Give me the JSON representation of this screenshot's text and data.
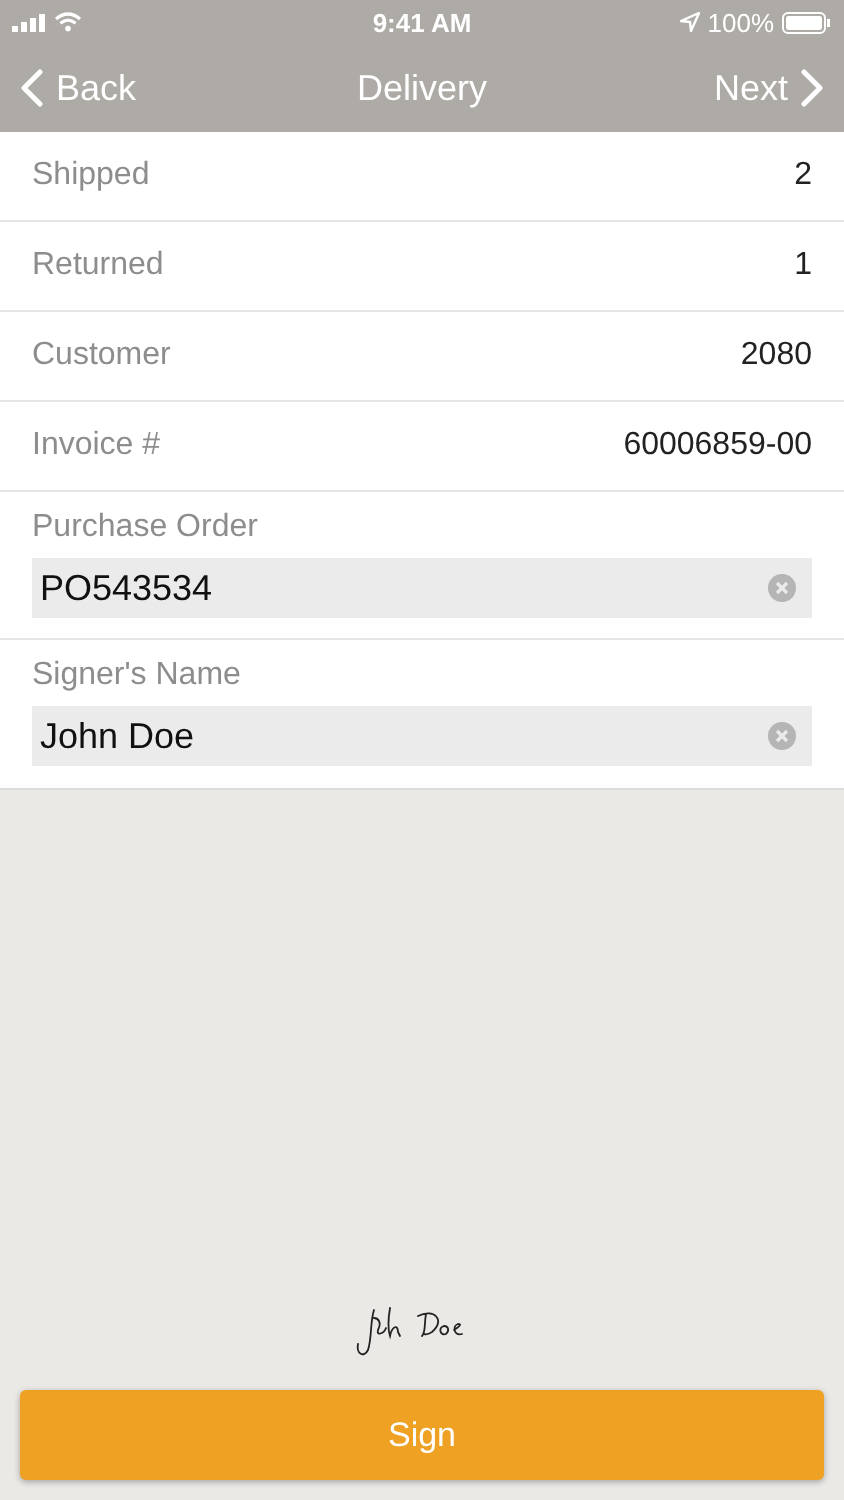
{
  "status_bar": {
    "time": "9:41 AM",
    "battery": "100%"
  },
  "nav": {
    "back": "Back",
    "title": "Delivery",
    "next": "Next"
  },
  "rows": [
    {
      "label": "Shipped",
      "value": "2"
    },
    {
      "label": "Returned",
      "value": "1"
    },
    {
      "label": "Customer",
      "value": "2080"
    },
    {
      "label": "Invoice #",
      "value": "60006859-00"
    }
  ],
  "fields": [
    {
      "label": "Purchase Order",
      "value": "PO543534"
    },
    {
      "label": "Signer's Name",
      "value": "John Doe"
    }
  ],
  "sign_button": "Sign"
}
